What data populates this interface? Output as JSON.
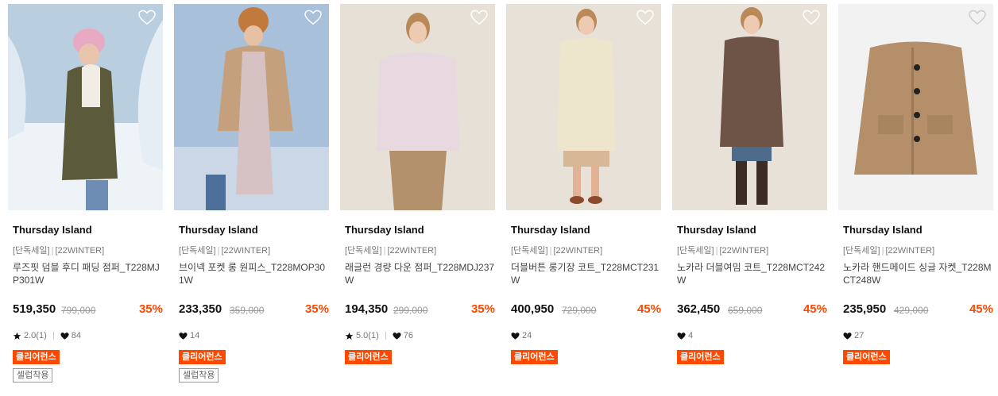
{
  "products": [
    {
      "brand": "Thursday Island",
      "tag1": "[단독세일]",
      "tag2": "[22WINTER]",
      "name": "루즈핏 덤블 후디 패딩 점퍼_T228MJP301W",
      "price": "519,350",
      "original_price": "799,000",
      "discount": "35%",
      "rating": "2.0(1)",
      "likes": "84",
      "badge": "클리어런스",
      "badge2": "셀럽착용",
      "icons": [
        "heart-outline-icon",
        "star-icon",
        "heart-filled-icon"
      ]
    },
    {
      "brand": "Thursday Island",
      "tag1": "[단독세일]",
      "tag2": "[22WINTER]",
      "name": "브이넥 포켓 롱 원피스_T228MOP301W",
      "price": "233,350",
      "original_price": "359,000",
      "discount": "35%",
      "likes": "14",
      "badge": "클리어런스",
      "badge2": "셀럽착용"
    },
    {
      "brand": "Thursday Island",
      "tag1": "[단독세일]",
      "tag2": "[22WINTER]",
      "name": "래글런 경량 다운 점퍼_T228MDJ237W",
      "price": "194,350",
      "original_price": "299,000",
      "discount": "35%",
      "rating": "5.0(1)",
      "likes": "76",
      "badge": "클리어런스"
    },
    {
      "brand": "Thursday Island",
      "tag1": "[단독세일]",
      "tag2": "[22WINTER]",
      "name": "더블버튼 롱기장 코트_T228MCT231W",
      "price": "400,950",
      "original_price": "729,000",
      "discount": "45%",
      "likes": "24",
      "badge": "클리어런스"
    },
    {
      "brand": "Thursday Island",
      "tag1": "[단독세일]",
      "tag2": "[22WINTER]",
      "name": "노카라 더블여밈 코트_T228MCT242W",
      "price": "362,450",
      "original_price": "659,000",
      "discount": "45%",
      "likes": "4",
      "badge": "클리어런스"
    },
    {
      "brand": "Thursday Island",
      "tag1": "[단독세일]",
      "tag2": "[22WINTER]",
      "name": "노카라 핸드메이드 싱글 자켓_T228MCT248W",
      "price": "235,950",
      "original_price": "429,000",
      "discount": "45%",
      "likes": "27",
      "badge": "클리어런스"
    }
  ],
  "colors": {
    "discount": "#ff4800",
    "badge_bg": "#ff4800",
    "text_dark": "#111111",
    "text_muted": "#777777"
  }
}
